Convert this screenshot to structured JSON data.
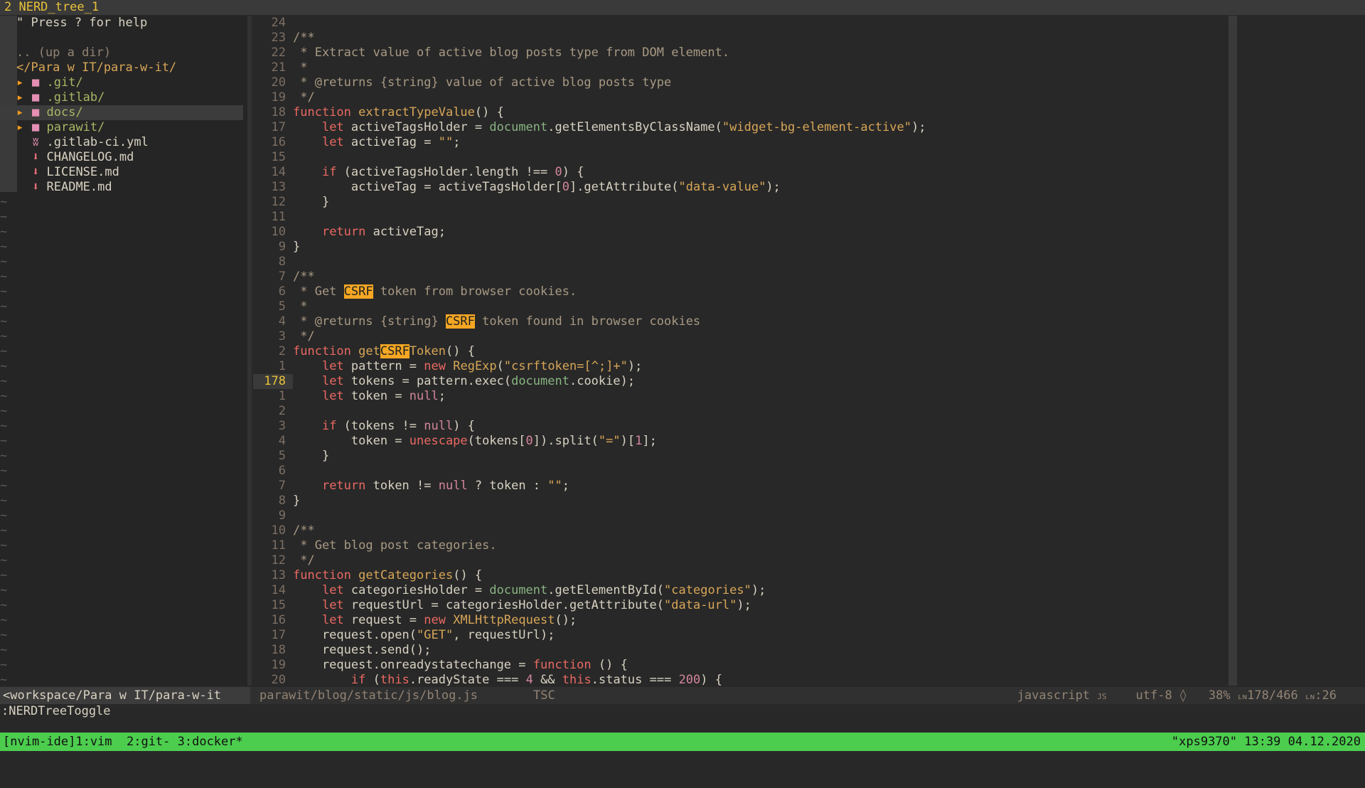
{
  "tabline": {
    "label": "2 NERD_tree_1"
  },
  "tree": {
    "help": "\" Press ? for help",
    "up_dir": ".. (up a dir)",
    "root": "</Para w IT/para-w-it/",
    "entries": [
      {
        "name": ".git/",
        "type": "folder"
      },
      {
        "name": ".gitlab/",
        "type": "folder"
      },
      {
        "name": "docs/",
        "type": "folder",
        "selected": true
      },
      {
        "name": "parawit/",
        "type": "folder"
      },
      {
        "name": ".gitlab-ci.yml",
        "type": "gitlab-file"
      },
      {
        "name": "CHANGELOG.md",
        "type": "md-file"
      },
      {
        "name": "LICENSE.md",
        "type": "md-file"
      },
      {
        "name": "README.md",
        "type": "md-file"
      }
    ]
  },
  "editor": {
    "current_line": "178",
    "line_numbers": [
      "24",
      "23",
      "22",
      "21",
      "20",
      "19",
      "18",
      "17",
      "16",
      "15",
      "14",
      "13",
      "12",
      "11",
      "10",
      "9",
      "8",
      "7",
      "6",
      "5",
      "4",
      "3",
      "2",
      "1",
      "178",
      "1",
      "2",
      "3",
      "4",
      "5",
      "6",
      "7",
      "8",
      "9",
      "10",
      "11",
      "12",
      "13",
      "14",
      "15",
      "16",
      "17",
      "18",
      "19",
      "20"
    ],
    "highlight_term": "CSRF"
  },
  "statusline": {
    "left": "<workspace/Para w IT/para-w-it",
    "file": "parawit/blog/static/js/blog.js",
    "tsc": "TSC",
    "filetype": "javascript",
    "filetype_icon": "JS",
    "encoding": "utf-8",
    "os_icon": "linux-tux-icon",
    "percent": "38%",
    "position": "178/466",
    "column": ":26"
  },
  "cmdline": ":NERDTreeToggle",
  "tmux": {
    "left": "[nvim-ide]1:vim  2:git- 3:docker*",
    "right": "\"xps9370\" 13:39 04.12.2020"
  }
}
